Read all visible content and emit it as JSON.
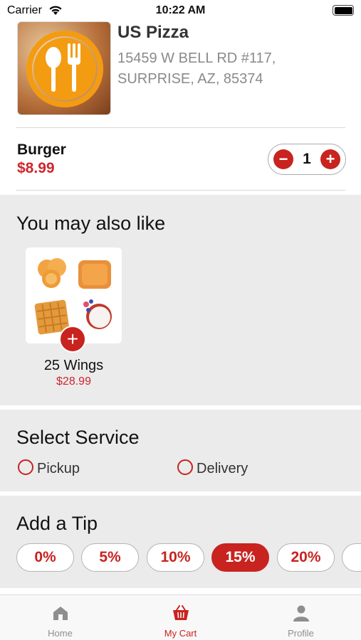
{
  "status_bar": {
    "carrier": "Carrier",
    "time": "10:22 AM"
  },
  "restaurant": {
    "name": "US Pizza",
    "address_line1": "15459 W BELL RD #117,",
    "address_line2": "SURPRISE, AZ, 85374",
    "logo_icon": "fork-spoon-icon"
  },
  "cart_item": {
    "name": "Burger",
    "price": "$8.99",
    "quantity": "1",
    "minus_label": "−",
    "plus_label": "+"
  },
  "suggestions": {
    "title": "You may also like",
    "items": [
      {
        "name": "25 Wings",
        "price": "$28.99",
        "add_label": "+"
      }
    ]
  },
  "service": {
    "title": "Select Service",
    "options": [
      {
        "label": "Pickup",
        "selected": false
      },
      {
        "label": "Delivery",
        "selected": false
      }
    ]
  },
  "tip": {
    "title": "Add a Tip",
    "options": [
      {
        "label": "0%",
        "selected": false
      },
      {
        "label": "5%",
        "selected": false
      },
      {
        "label": "10%",
        "selected": false
      },
      {
        "label": "15%",
        "selected": true
      },
      {
        "label": "20%",
        "selected": false
      }
    ]
  },
  "tab_bar": {
    "tabs": [
      {
        "label": "Home",
        "icon": "house-icon",
        "active": false
      },
      {
        "label": "My Cart",
        "icon": "basket-icon",
        "active": true
      },
      {
        "label": "Profile",
        "icon": "person-icon",
        "active": false
      }
    ]
  },
  "colors": {
    "accent": "#c8231f",
    "price": "#d0262d",
    "section_bg": "#ebebeb",
    "logo_orange": "#f39c12"
  }
}
